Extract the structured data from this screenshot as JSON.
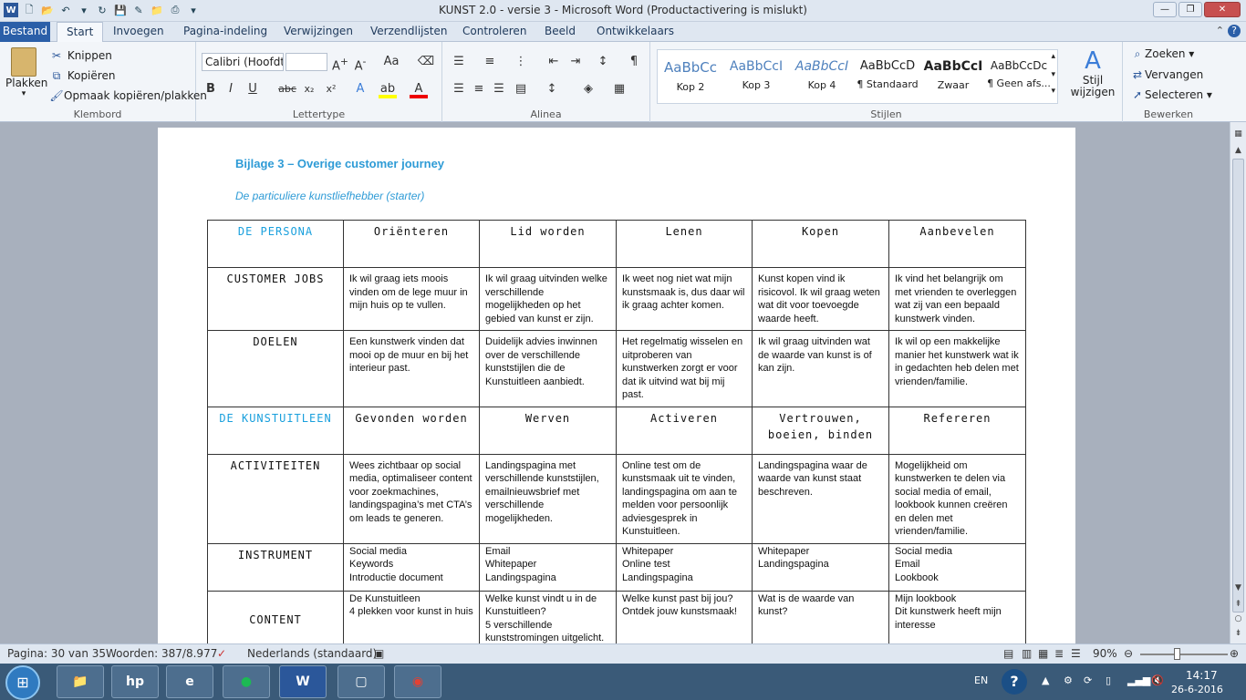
{
  "window": {
    "title": "KUNST 2.0 - versie 3  -  Microsoft Word (Productactivering is mislukt)"
  },
  "qat": {
    "app_icon": "W"
  },
  "tabs": [
    "Bestand",
    "Start",
    "Invoegen",
    "Pagina-indeling",
    "Verwijzingen",
    "Verzendlijsten",
    "Controleren",
    "Beeld",
    "Ontwikkelaars"
  ],
  "ribbon": {
    "clipboard": {
      "paste": "Plakken",
      "cut": "Knippen",
      "copy": "Kopiëren",
      "format_painter": "Opmaak kopiëren/plakken",
      "label": "Klembord"
    },
    "font": {
      "name": "Calibri (Hoofdt",
      "size": "",
      "label": "Lettertype"
    },
    "paragraph": {
      "label": "Alinea"
    },
    "styles": {
      "items": [
        {
          "preview": "AaBbCc",
          "name": "Kop 2"
        },
        {
          "preview": "AaBbCcI",
          "name": "Kop 3"
        },
        {
          "preview": "AaBbCcI",
          "name": "Kop 4"
        },
        {
          "preview": "AaBbCcD",
          "name": "¶ Standaard"
        },
        {
          "preview": "AaBbCcI",
          "name": "Zwaar"
        },
        {
          "preview": "AaBbCcDc",
          "name": "¶ Geen afs..."
        }
      ],
      "change": "Stijl wijzigen",
      "label": "Stijlen"
    },
    "editing": {
      "find": "Zoeken",
      "replace": "Vervangen",
      "select": "Selecteren",
      "label": "Bewerken"
    }
  },
  "document": {
    "heading": "Bijlage 3 – Overige customer journey",
    "subheading": "De particuliere kunstliefhebber  (starter)",
    "table": {
      "persona_header": [
        "DE PERSONA",
        "Oriënteren",
        "Lid worden",
        "Lenen",
        "Kopen",
        "Aanbevelen"
      ],
      "rows1": [
        {
          "label": "CUSTOMER JOBS",
          "cells": [
            "Ik wil graag iets moois vinden om de lege muur in mijn huis op te vullen.",
            "Ik wil graag uitvinden welke verschillende mogelijkheden op het gebied van kunst er zijn.",
            "Ik weet nog niet wat mijn kunstsmaak is, dus daar wil ik graag achter komen.",
            "Kunst kopen vind ik risicovol. Ik wil graag weten wat dit voor toevoegde waarde heeft.",
            "Ik vind het belangrijk om met vrienden te overleggen wat zij van een bepaald kunstwerk vinden."
          ]
        },
        {
          "label": "DOELEN",
          "cells": [
            "Een kunstwerk vinden dat mooi op de muur en bij het interieur past.",
            "Duidelijk advies inwinnen over de verschillende kunststijlen die de Kunstuitleen aanbiedt.",
            "Het regelmatig wisselen en uitproberen van kunstwerken zorgt er voor dat ik uitvind wat bij mij past.",
            "Ik wil graag uitvinden wat de waarde van kunst is of kan zijn.",
            "Ik wil op een makkelijke manier het kunstwerk wat ik in gedachten heb delen met vrienden/familie."
          ]
        }
      ],
      "kunstuitleen_header": [
        "DE KUNSTUITLEEN",
        "Gevonden worden",
        "Werven",
        "Activeren",
        "Vertrouwen, boeien, binden",
        "Refereren"
      ],
      "rows2": [
        {
          "label": "ACTIVITEITEN",
          "cells": [
            "Wees zichtbaar op social media, optimaliseer content voor zoekmachines, landingspagina’s met CTA’s om leads te generen.",
            "Landingspagina met verschillende kunststijlen, emailnieuwsbrief met verschillende mogelijkheden.",
            "Online test om de kunstsmaak uit te vinden, landingspagina om aan te melden voor persoonlijk adviesgesprek in Kunstuitleen.",
            "Landingspagina waar de waarde van kunst staat beschreven.",
            "Mogelijkheid om kunstwerken te delen via social media of email, lookbook kunnen creëren en delen met vrienden/familie."
          ]
        },
        {
          "label": "INSTRUMENT",
          "cells": [
            "Social media\nKeywords\nIntroductie document",
            "Email\nWhitepaper\nLandingspagina",
            "Whitepaper\nOnline test\nLandingspagina",
            "Whitepaper\nLandingspagina",
            "Social media\nEmail\nLookbook"
          ]
        },
        {
          "label": "CONTENT",
          "cells": [
            "De Kunstuitleen\n4 plekken voor kunst in huis",
            "Welke kunst vindt u in de Kunstuitleen?\n5 verschillende kunststromingen uitgelicht.",
            "Welke kunst past bij jou? Ontdek jouw kunstsmaak!",
            "Wat is de waarde van kunst?",
            "Mijn lookbook\nDit kunstwerk heeft mijn interesse"
          ]
        }
      ]
    }
  },
  "status": {
    "page": "Pagina: 30 van 35",
    "words": "Woorden: 387/8.977",
    "language": "Nederlands (standaard)",
    "zoom": "90%"
  },
  "taskbar": {
    "lang": "EN",
    "time": "14:17",
    "date": "26-6-2016"
  }
}
